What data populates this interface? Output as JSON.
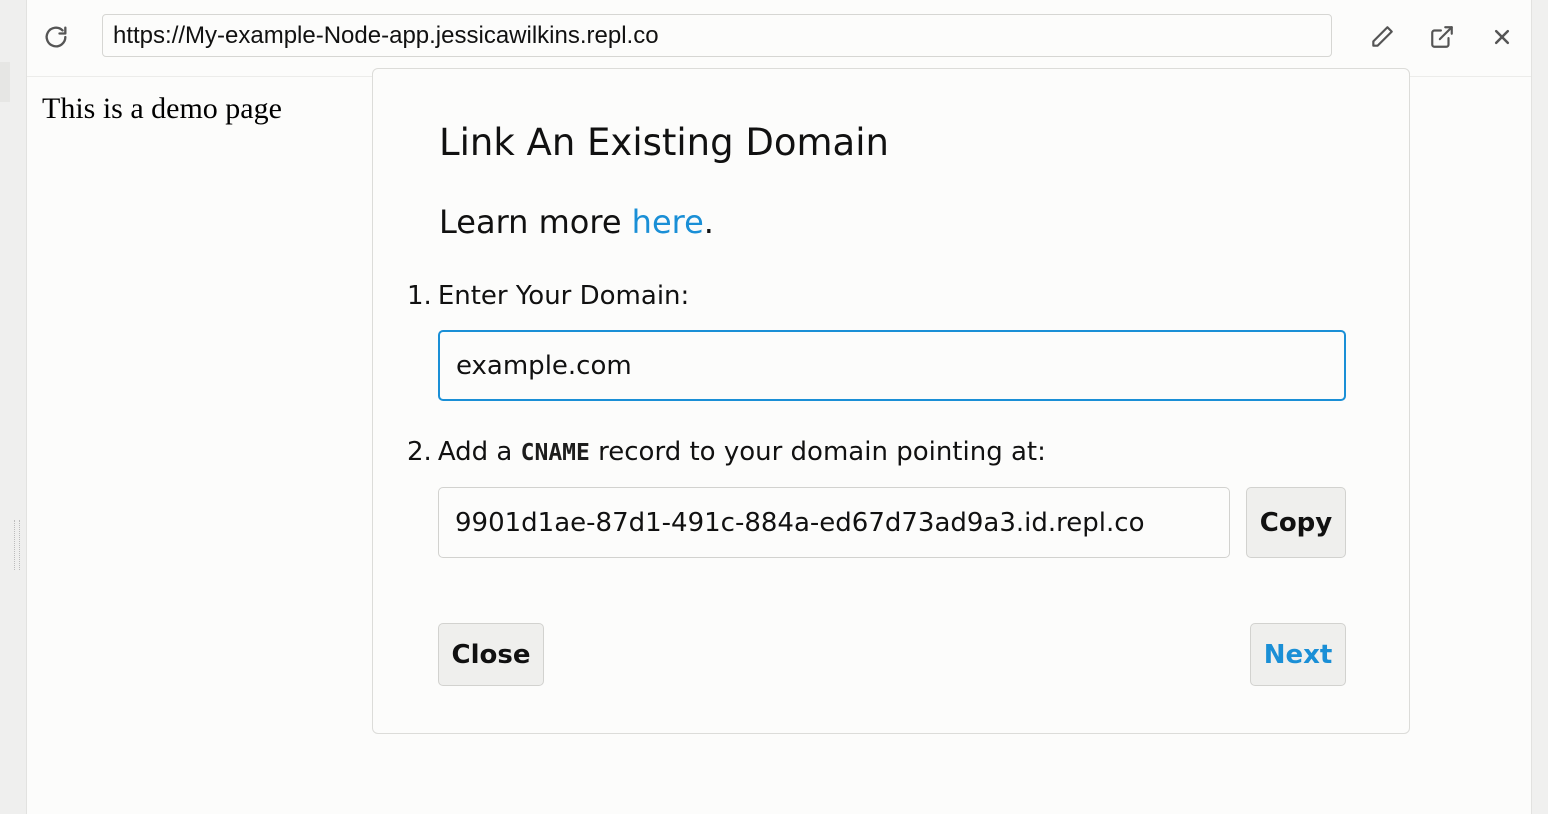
{
  "toolbar": {
    "url": "https://My-example-Node-app.jessicawilkins.repl.co",
    "reload_icon": "reload-icon",
    "edit_icon": "pencil-icon",
    "open_external_icon": "external-link-icon",
    "close_icon": "close-icon"
  },
  "page": {
    "demo_text": "This is a demo page"
  },
  "modal": {
    "title": "Link An Existing Domain",
    "learn_more_prefix": "Learn more ",
    "learn_more_link": "here",
    "learn_more_suffix": ".",
    "step1": {
      "number": "1.",
      "label": "Enter Your Domain:",
      "input_value": "example.com"
    },
    "step2": {
      "number": "2.",
      "label_prefix": "Add a ",
      "label_code": "CNAME",
      "label_suffix": " record to your domain pointing at:",
      "cname_target": "9901d1ae-87d1-491c-884a-ed67d73ad9a3.id.repl.co",
      "copy_label": "Copy"
    },
    "close_label": "Close",
    "next_label": "Next"
  },
  "colors": {
    "accent": "#1a8fd6",
    "background": "#fcfcfb",
    "border": "#d2d2cf"
  }
}
